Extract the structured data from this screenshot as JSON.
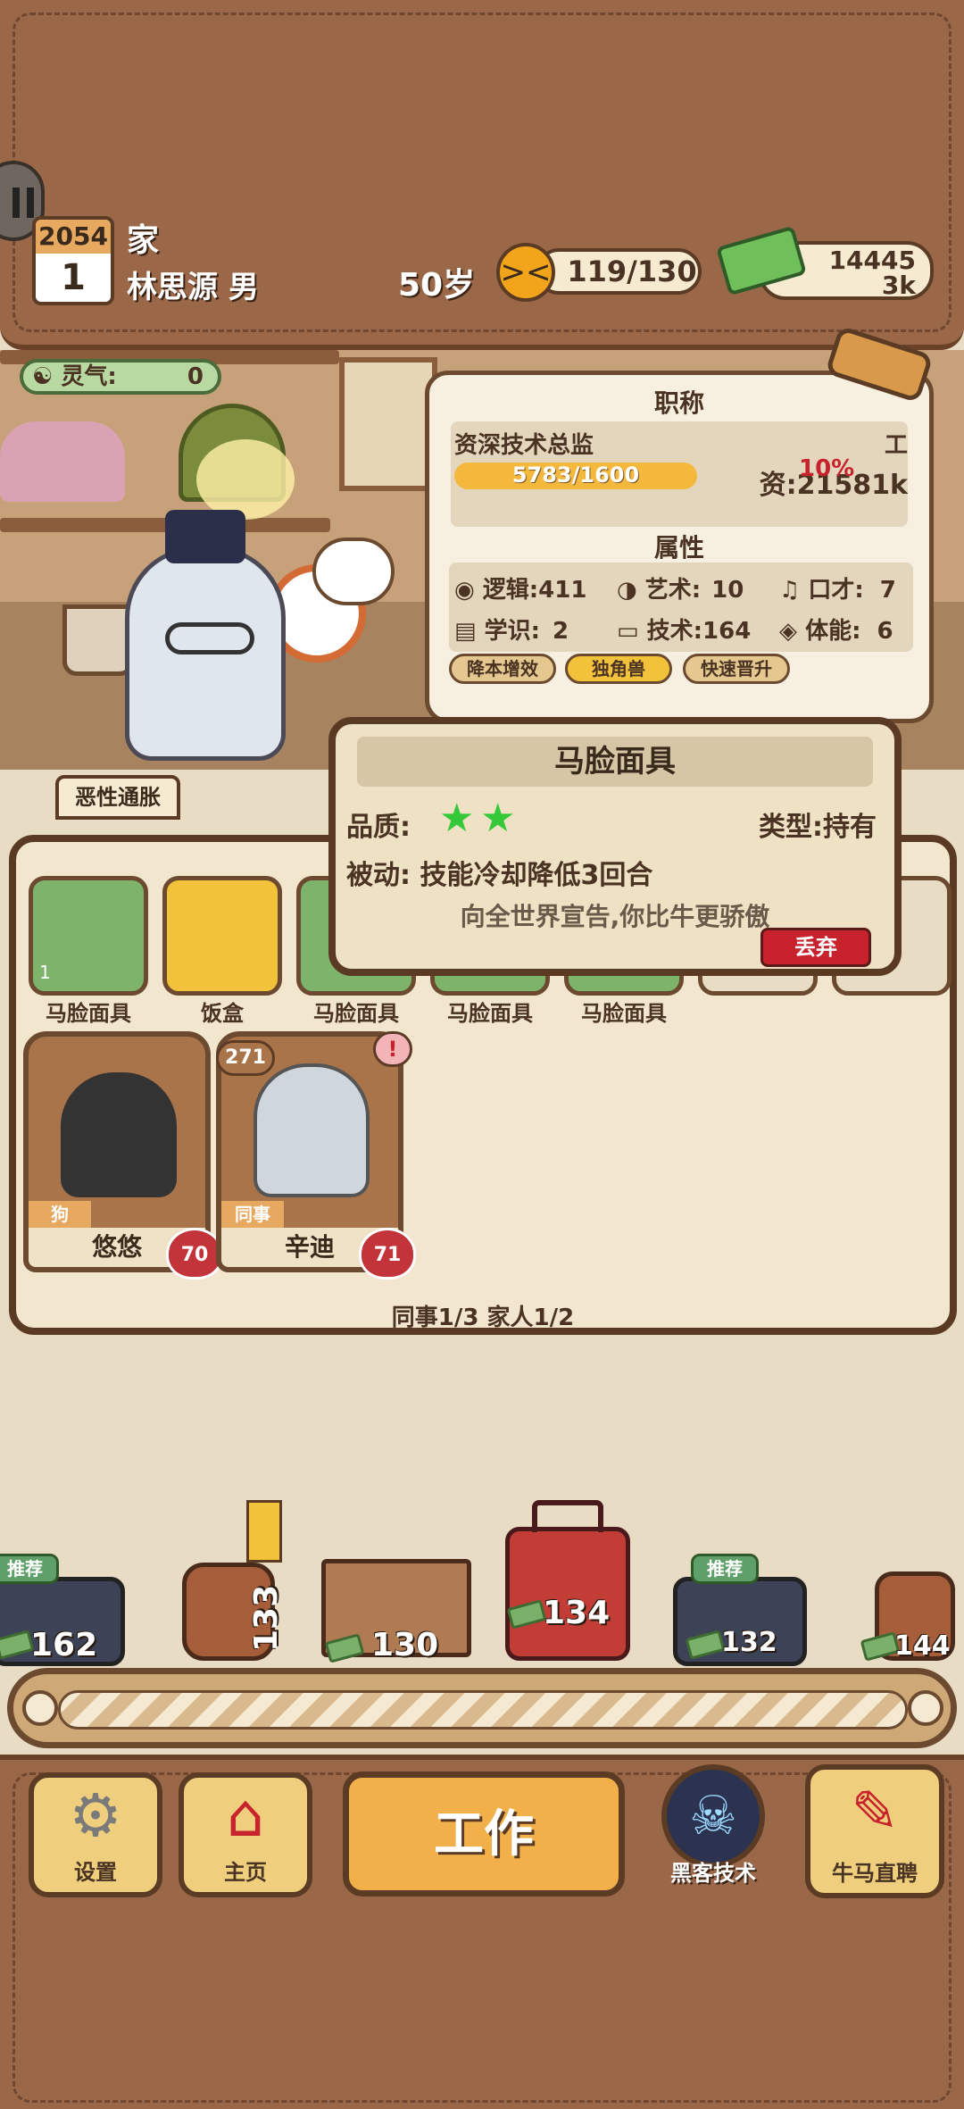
{
  "header": {
    "year": "2054",
    "day": "1",
    "location": "家",
    "player_name": "林思源 男",
    "age": "50岁",
    "stamina": "119/130",
    "money_line1": "14445",
    "money_line2": "3k",
    "side_button_icon": "pause-icon"
  },
  "room": {
    "luck_label": "灵气:",
    "luck_value": "0"
  },
  "job_card": {
    "title_header": "职称",
    "job_title": "资深技术总监",
    "job_tag": "工",
    "progress_text": "5783/1600",
    "progress_fraction": 1.0,
    "salary_text": "资:21581k",
    "bonus_text": "10%",
    "attributes_header": "属性",
    "attributes": [
      {
        "icon": "brain-icon",
        "label": "逻辑:",
        "value": "411"
      },
      {
        "icon": "lips-icon",
        "label": "艺术:",
        "value": "10"
      },
      {
        "icon": "music-note-icon",
        "label": "口才:",
        "value": "7"
      },
      {
        "icon": "book-icon",
        "label": "学识:",
        "value": "2"
      },
      {
        "icon": "monitor-icon",
        "label": "技术:",
        "value": "164"
      },
      {
        "icon": "shield-icon",
        "label": "体能:",
        "value": "6"
      }
    ],
    "tags": [
      "降本增效",
      "独角兽",
      "快速晋升"
    ]
  },
  "status_tag": "恶性通胀",
  "inventory": {
    "items": [
      {
        "label": "马脸面具",
        "icon": "horse-mask-icon",
        "count": "1",
        "color": "#7db36a"
      },
      {
        "label": "饭盒",
        "icon": "bento-box-icon",
        "color": "#f2c23b"
      },
      {
        "label": "马脸面具",
        "icon": "horse-mask-icon",
        "count": "1",
        "color": "#7db36a"
      },
      {
        "label": "马脸面具",
        "icon": "horse-mask-icon",
        "color": "#7db36a"
      },
      {
        "label": "马脸面具",
        "icon": "horse-mask-icon",
        "color": "#7db36a"
      }
    ],
    "characters": [
      {
        "role": "狗",
        "name": "悠悠",
        "heart": "70",
        "icon": "black-dog-icon"
      },
      {
        "role": "同事",
        "name": "辛迪",
        "heart": "71",
        "badge": "271",
        "alert": "!",
        "icon": "silver-hair-character-icon"
      }
    ],
    "summary": "同事1/3 家人1/2"
  },
  "tooltip": {
    "title": "马脸面具",
    "quality_label": "品质:",
    "stars": 2,
    "type_text": "类型:持有",
    "passive_text": "被动: 技能冷却降低3回合",
    "flavor_text": "向全世界宣告,你比牛更骄傲",
    "discard_label": "丢弃"
  },
  "conveyor": {
    "items": [
      {
        "icon": "game-console-icon",
        "price": "162",
        "recommend": "推荐"
      },
      {
        "icon": "barrel-icon",
        "price": "133"
      },
      {
        "icon": "cardboard-box-icon",
        "price": "130"
      },
      {
        "icon": "suitcase-icon",
        "price": "134"
      },
      {
        "icon": "game-console-icon",
        "price": "132",
        "recommend": "推荐"
      },
      {
        "icon": "barrel-icon",
        "price": "144"
      }
    ]
  },
  "bottom_nav": {
    "settings": "设置",
    "home": "主页",
    "work": "工作",
    "hacker": "黑客技术",
    "recruit": "牛马直聘"
  },
  "colors": {
    "leather": "#9a6848",
    "progress": "#f4b93c",
    "discard": "#c8232c",
    "star": "#35c93a"
  }
}
